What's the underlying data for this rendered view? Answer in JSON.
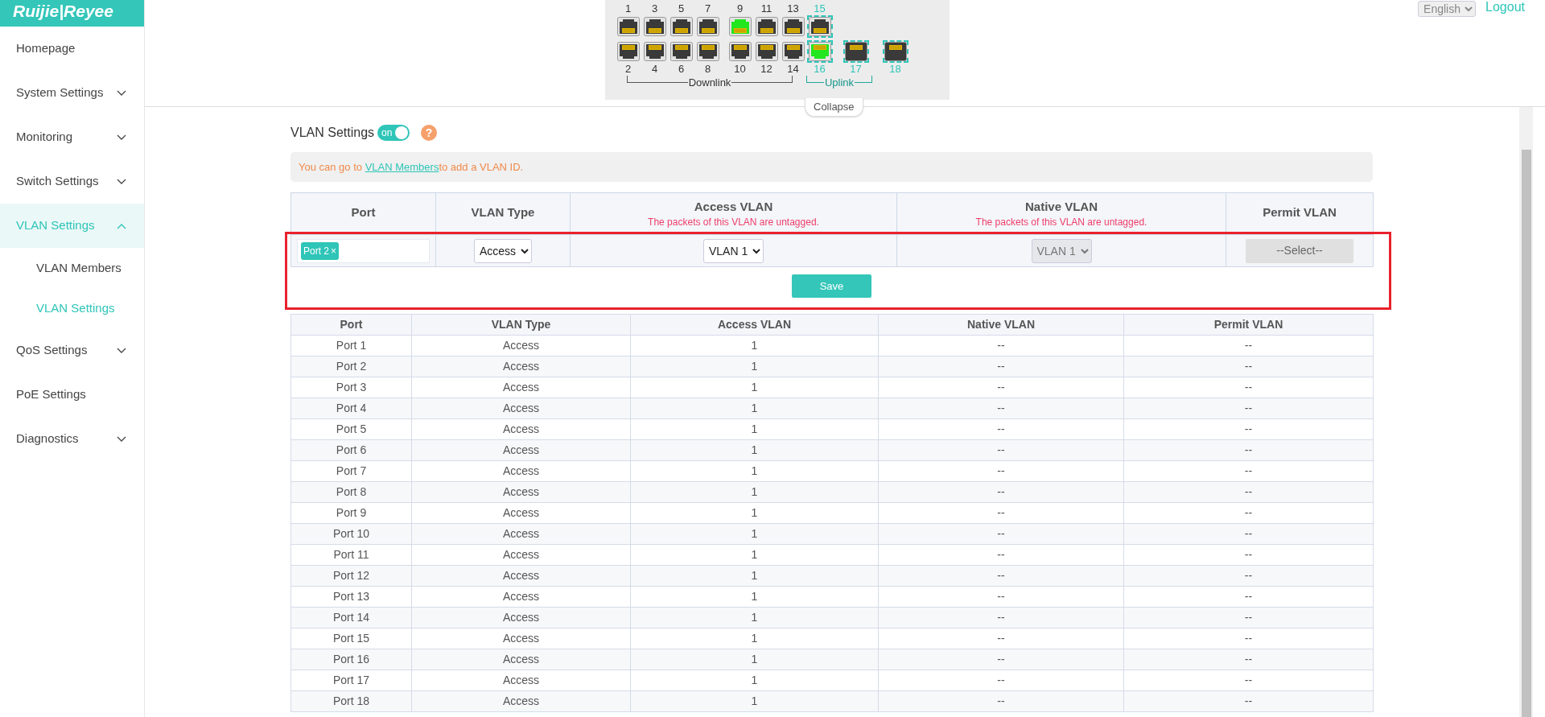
{
  "brand": {
    "logo": "Ruijie|Reyee"
  },
  "sidebar": {
    "items": [
      {
        "label": "Homepage",
        "kind": "link",
        "selected": false
      },
      {
        "label": "System Settings",
        "kind": "group",
        "expanded": false,
        "selected": false
      },
      {
        "label": "Monitoring",
        "kind": "group",
        "expanded": false,
        "selected": false
      },
      {
        "label": "Switch Settings",
        "kind": "group",
        "expanded": false,
        "selected": false
      },
      {
        "label": "VLAN Settings",
        "kind": "group",
        "expanded": true,
        "selected": true,
        "children": [
          {
            "label": "VLAN Members",
            "selected": false
          },
          {
            "label": "VLAN Settings",
            "selected": true
          }
        ]
      },
      {
        "label": "QoS Settings",
        "kind": "group",
        "expanded": false,
        "selected": false
      },
      {
        "label": "PoE Settings",
        "kind": "link",
        "selected": false
      },
      {
        "label": "Diagnostics",
        "kind": "group",
        "expanded": false,
        "selected": false
      }
    ]
  },
  "port_panel": {
    "top_row": [
      {
        "label": "1",
        "kind": "rj45",
        "connected": false,
        "uplink": false
      },
      {
        "label": "3",
        "kind": "rj45",
        "connected": false,
        "uplink": false
      },
      {
        "label": "5",
        "kind": "rj45",
        "connected": false,
        "uplink": false
      },
      {
        "label": "7",
        "kind": "rj45",
        "connected": false,
        "uplink": false
      },
      {
        "label": "9",
        "kind": "rj45",
        "connected": true,
        "uplink": false
      },
      {
        "label": "11",
        "kind": "rj45",
        "connected": false,
        "uplink": false
      },
      {
        "label": "13",
        "kind": "rj45",
        "connected": false,
        "uplink": false
      },
      {
        "label": "15",
        "kind": "rj45",
        "connected": false,
        "uplink": true
      }
    ],
    "bottom_row": [
      {
        "label": "2",
        "kind": "rj45",
        "connected": false,
        "uplink": false
      },
      {
        "label": "4",
        "kind": "rj45",
        "connected": false,
        "uplink": false
      },
      {
        "label": "6",
        "kind": "rj45",
        "connected": false,
        "uplink": false
      },
      {
        "label": "8",
        "kind": "rj45",
        "connected": false,
        "uplink": false
      },
      {
        "label": "10",
        "kind": "rj45",
        "connected": false,
        "uplink": false
      },
      {
        "label": "12",
        "kind": "rj45",
        "connected": false,
        "uplink": false
      },
      {
        "label": "14",
        "kind": "rj45",
        "connected": false,
        "uplink": false
      },
      {
        "label": "16",
        "kind": "rj45",
        "connected": true,
        "uplink": true
      },
      {
        "label": "17",
        "kind": "sfp",
        "connected": false,
        "uplink": true
      },
      {
        "label": "18",
        "kind": "sfp",
        "connected": false,
        "uplink": true
      }
    ],
    "groups": [
      {
        "label": "Downlink",
        "kind": "downlink"
      },
      {
        "label": "Uplink",
        "kind": "uplink"
      }
    ],
    "collapse": "Collapse"
  },
  "header": {
    "language": "English",
    "logout": "Logout"
  },
  "vlan_settings": {
    "title": "VLAN Settings",
    "toggle": {
      "label": "on",
      "on": true
    },
    "help": "?"
  },
  "notice": {
    "before": "You can go to ",
    "link": "VLAN Members",
    "after": "to add a VLAN ID."
  },
  "edit_table": {
    "columns": [
      {
        "title": "Port"
      },
      {
        "title": "VLAN Type"
      },
      {
        "title": "Access VLAN",
        "note": "The packets of this VLAN are untagged."
      },
      {
        "title": "Native VLAN",
        "note": "The packets of this VLAN are untagged."
      },
      {
        "title": "Permit VLAN"
      }
    ],
    "row": {
      "port_tags": [
        {
          "label": "Port 2",
          "remove": "×"
        }
      ],
      "vlan_type": {
        "value": "Access",
        "disabled": false
      },
      "access_vlan": {
        "value": "VLAN 1",
        "disabled": false
      },
      "native_vlan": {
        "value": "VLAN 1",
        "disabled": true
      },
      "permit_vlan": {
        "value": "--Select--",
        "disabled": true
      }
    },
    "save": "Save"
  },
  "table": {
    "columns": [
      "Port",
      "VLAN Type",
      "Access VLAN",
      "Native VLAN",
      "Permit VLAN"
    ],
    "rows": [
      [
        "Port 1",
        "Access",
        "1",
        "--",
        "--"
      ],
      [
        "Port 2",
        "Access",
        "1",
        "--",
        "--"
      ],
      [
        "Port 3",
        "Access",
        "1",
        "--",
        "--"
      ],
      [
        "Port 4",
        "Access",
        "1",
        "--",
        "--"
      ],
      [
        "Port 5",
        "Access",
        "1",
        "--",
        "--"
      ],
      [
        "Port 6",
        "Access",
        "1",
        "--",
        "--"
      ],
      [
        "Port 7",
        "Access",
        "1",
        "--",
        "--"
      ],
      [
        "Port 8",
        "Access",
        "1",
        "--",
        "--"
      ],
      [
        "Port 9",
        "Access",
        "1",
        "--",
        "--"
      ],
      [
        "Port 10",
        "Access",
        "1",
        "--",
        "--"
      ],
      [
        "Port 11",
        "Access",
        "1",
        "--",
        "--"
      ],
      [
        "Port 12",
        "Access",
        "1",
        "--",
        "--"
      ],
      [
        "Port 13",
        "Access",
        "1",
        "--",
        "--"
      ],
      [
        "Port 14",
        "Access",
        "1",
        "--",
        "--"
      ],
      [
        "Port 15",
        "Access",
        "1",
        "--",
        "--"
      ],
      [
        "Port 16",
        "Access",
        "1",
        "--",
        "--"
      ],
      [
        "Port 17",
        "Access",
        "1",
        "--",
        "--"
      ],
      [
        "Port 18",
        "Access",
        "1",
        "--",
        "--"
      ]
    ]
  }
}
